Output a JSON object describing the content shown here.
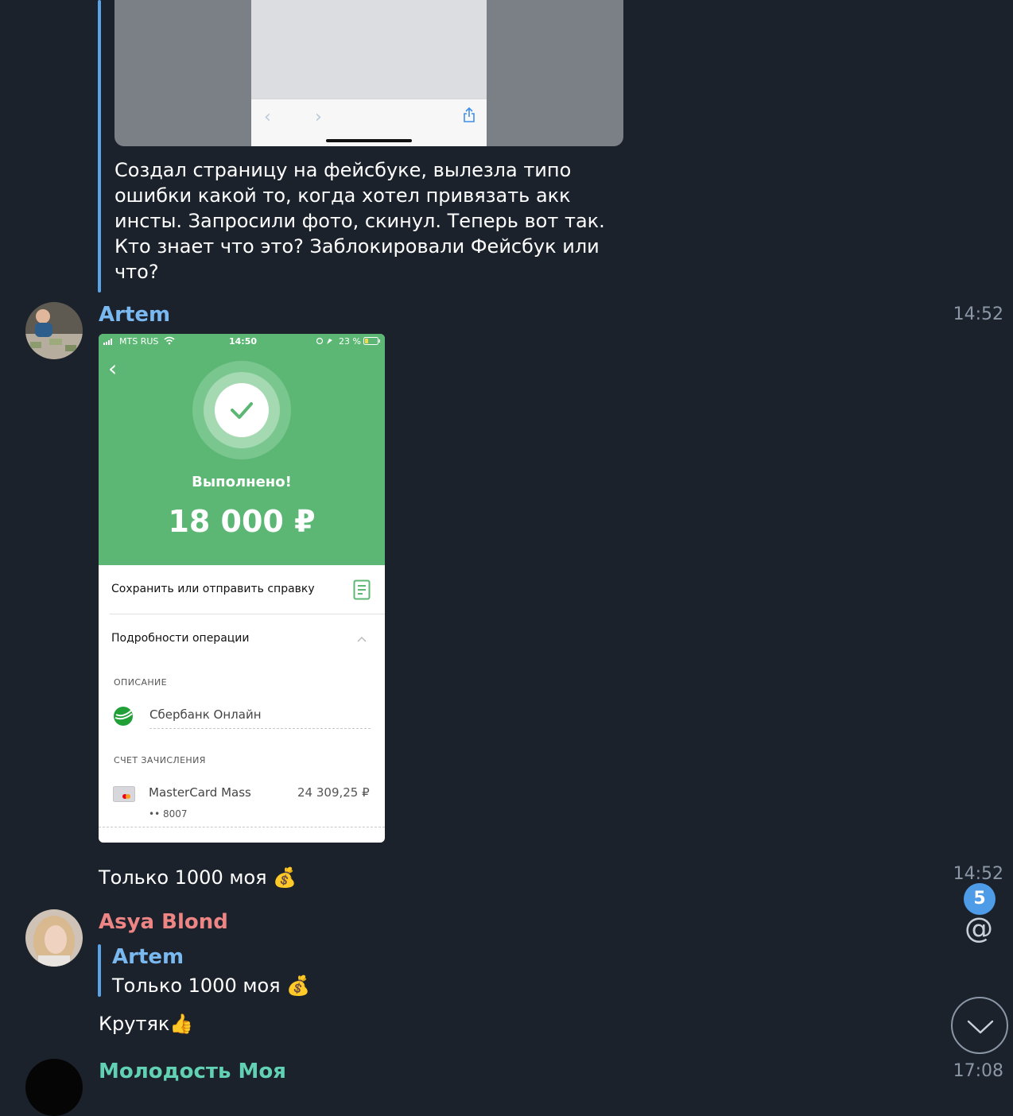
{
  "top_message": {
    "text": "Создал страницу на фейсбуке, вылезла типо ошибки какой то, когда хотел привязать акк инсты. Запросили фото, скинул. Теперь вот так. Кто знает что это? Заблокировали Фейсбук или что?",
    "nav_back": "‹",
    "nav_forward": "›",
    "share_icon": "share-icon"
  },
  "artem_post": {
    "sender": "Artem",
    "time": "14:52",
    "receipt": {
      "carrier": "MTS RUS",
      "clock": "14:50",
      "battery": "23 %",
      "back": "‹",
      "status": "Выполнено!",
      "amount": "18 000 ₽",
      "save_row": "Сохранить или отправить справку",
      "details_row": "Подробности операции",
      "description_caption": "ОПИСАНИЕ",
      "description_value": "Сбербанк Онлайн",
      "account_caption": "СЧЕТ ЗАЧИСЛЕНИЯ",
      "card_name": "MasterCard Mass",
      "card_number": "•• 8007",
      "card_balance": "24 309,25 ₽",
      "accent_color": "#5cb774"
    }
  },
  "artem_text_message": {
    "text": "Только 1000 моя",
    "emoji": "💰",
    "time": "14:52"
  },
  "asya_post": {
    "sender": "Asya Blond",
    "reply_sender": "Artem",
    "reply_text": "Только 1000 моя",
    "reply_emoji": "💰",
    "text": "Крутяк",
    "emoji": "👍"
  },
  "last_post": {
    "sender": "Молодость Моя",
    "time": "17:08"
  },
  "widgets": {
    "unread_badge": "5",
    "mention_symbol": "@"
  },
  "colors": {
    "background": "#1b222c",
    "artem_name": "#7ab8f0",
    "asya_name": "#ee8585",
    "third_name": "#62d1b3",
    "quote_bar": "#5aa3e6",
    "badge": "#4e9be8"
  }
}
